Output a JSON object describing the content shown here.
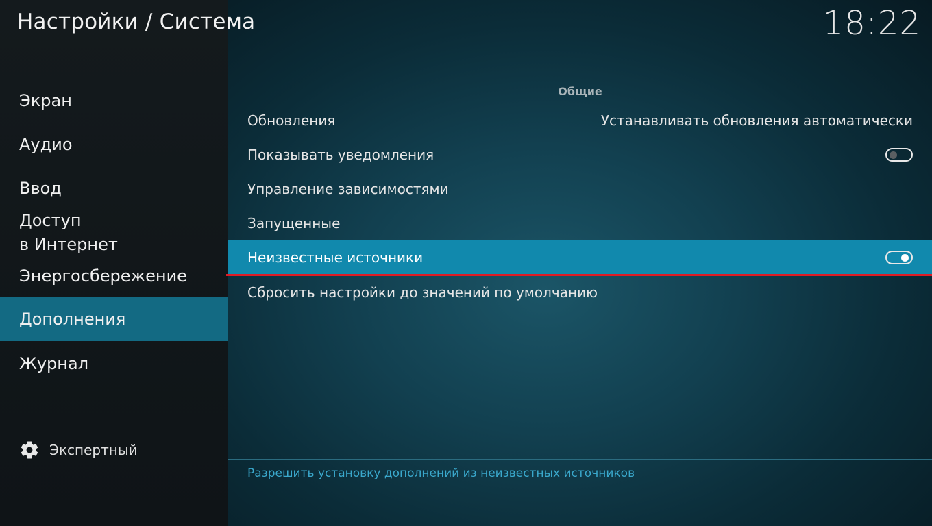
{
  "header": {
    "title": "Настройки / Система",
    "clock": "18:22"
  },
  "sidebar": {
    "items": [
      {
        "label": "Экран"
      },
      {
        "label": "Аудио"
      },
      {
        "label": "Ввод"
      },
      {
        "label": "Доступ\nв Интернет"
      },
      {
        "label": "Энергосбережение"
      },
      {
        "label": "Дополнения",
        "active": true
      },
      {
        "label": "Журнал"
      }
    ],
    "expert_label": "Экспертный"
  },
  "main": {
    "section_title": "Общие",
    "settings": [
      {
        "label": "Обновления",
        "value": "Устанавливать обновления автоматически"
      },
      {
        "label": "Показывать уведомления",
        "toggle": "off"
      },
      {
        "label": "Управление зависимостями"
      },
      {
        "label": "Запущенные"
      },
      {
        "label": "Неизвестные источники",
        "toggle": "on",
        "selected": true
      },
      {
        "label": "Сбросить настройки до значений по умолчанию"
      }
    ],
    "description": "Разрешить установку дополнений из неизвестных источников"
  },
  "colors": {
    "accent_selected": "#1189ad",
    "sidebar_active": "#136a83",
    "description_text": "#3aa8cc",
    "highlight_line": "#e01b24"
  }
}
